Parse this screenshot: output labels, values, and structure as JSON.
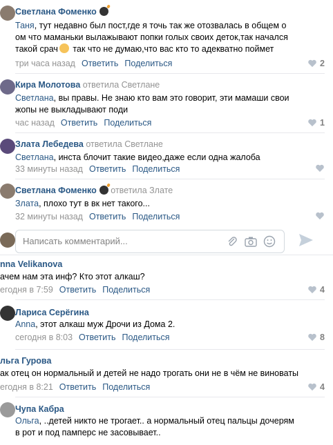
{
  "comments": [
    {
      "author": "Светлана Фоменко",
      "replied_to": "",
      "mention": "Таня",
      "lines": [
        ", тут недавно был пост,где я точь так же отозвалась в общем о",
        "ом что маманьки вылажывают попки голых своих деток,так начался",
        "такой срач",
        " так что не думаю,что вас кто то адекватно поймет"
      ],
      "time": "три часа назад",
      "reply": "Ответить",
      "share": "Поделиться",
      "likes": "2",
      "avatar_color": "#8a7b6e"
    },
    {
      "author": "Кира Молотова",
      "replied_to": "ответила Светлане",
      "mention": "Светлана",
      "lines": [
        ", вы правы. Не знаю кто вам это говорит, эти мамаши свои",
        "жопы не выкладывают поди"
      ],
      "time": "час назад",
      "reply": "Ответить",
      "share": "Поделиться",
      "likes": "1",
      "avatar_color": "#6e6a8a"
    },
    {
      "author": "Злата Лебедева",
      "replied_to": "ответила Светлане",
      "mention": "Светлана",
      "lines": [
        ", инста блочит такие видео,даже если одна жалоба"
      ],
      "time": "33 минуты назад",
      "reply": "Ответить",
      "share": "Поделиться",
      "likes": "",
      "avatar_color": "#5a4a7a"
    },
    {
      "author": "Светлана Фоменко",
      "replied_to": "ответила Злате",
      "mention": "Злата",
      "lines": [
        ", плохо тут в вк нет такого..."
      ],
      "time": "32 минуты назад",
      "reply": "Ответить",
      "share": "Поделиться",
      "likes": "",
      "avatar_color": "#8a7b6e"
    }
  ],
  "input": {
    "placeholder": "Написать комментарий..."
  },
  "comments2": [
    {
      "author": "nna Velikanova",
      "mention": "",
      "lines": [
        "ачем нам эта инф? Кто этот алкаш?"
      ],
      "time": "егодня в 7:59",
      "reply": "Ответить",
      "share": "Поделиться",
      "likes": "4"
    },
    {
      "author": "Лариса Серёгина",
      "mention": "Anna",
      "lines": [
        ", этот алкаш муж Дрочи из Дома 2."
      ],
      "time": "сегодня в 8:03",
      "reply": "Ответить",
      "share": "Поделиться",
      "likes": "8",
      "avatar_color": "#333333"
    },
    {
      "author": "льга Гурова",
      "mention": "",
      "lines": [
        "ак отец он нормальный и детей не надо трогать они не в чём не виноваты"
      ],
      "time": "егодня в 8:21",
      "reply": "Ответить",
      "share": "Поделиться",
      "likes": "4"
    },
    {
      "author": "Чупа Кабра",
      "mention": "Ольга",
      "lines": [
        ", ..детей никто не трогает.. а нормальный отец пальцы дочерям",
        "в рот и под памперс не засовывает.."
      ],
      "time": "",
      "reply": "",
      "share": "",
      "likes": "",
      "avatar_color": "#9a9a9a"
    }
  ],
  "colors": {
    "link": "#2a5885",
    "meta": "#939393",
    "separator": "#e7e8ec"
  }
}
